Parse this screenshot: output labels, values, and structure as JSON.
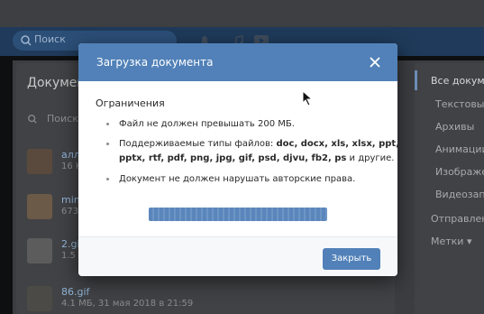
{
  "header": {
    "search_placeholder": "Поиск"
  },
  "documents_panel": {
    "title": "Докумен",
    "search_placeholder": "Поиск",
    "items": [
      {
        "name": "алл",
        "meta": "16 К"
      },
      {
        "name": "min",
        "meta": "673"
      },
      {
        "name": "2.gi",
        "meta": "1.5 "
      },
      {
        "name": "86.gif",
        "meta": "4.1 МБ, 31 мая 2018 в 21:59"
      }
    ]
  },
  "right_menu": {
    "items": [
      "Все докумен",
      "Текстовые",
      "Архивы",
      "Анимации",
      "Изображен",
      "Видеозапи",
      "Отправлен",
      "Метки ▾"
    ]
  },
  "modal": {
    "title": "Загрузка документа",
    "section_title": "Ограничения",
    "rule_size": "Файл не должен превышать 200 МБ.",
    "rule_types_prefix": "Поддерживаемые типы файлов: ",
    "rule_types_line1": "doc, docx, xls, xlsx, ppt,",
    "rule_types_line2": "pptx, rtf, pdf, png, jpg, gif, psd, djvu, fb2, ps",
    "rule_types_suffix": " и другие.",
    "rule_copyright": "Документ не должен нарушать авторские права.",
    "upload_progress": 1.0,
    "close_button": "Закрыть"
  },
  "colors": {
    "accent": "#5181b8",
    "overlay_bg": "#0e0f10"
  }
}
